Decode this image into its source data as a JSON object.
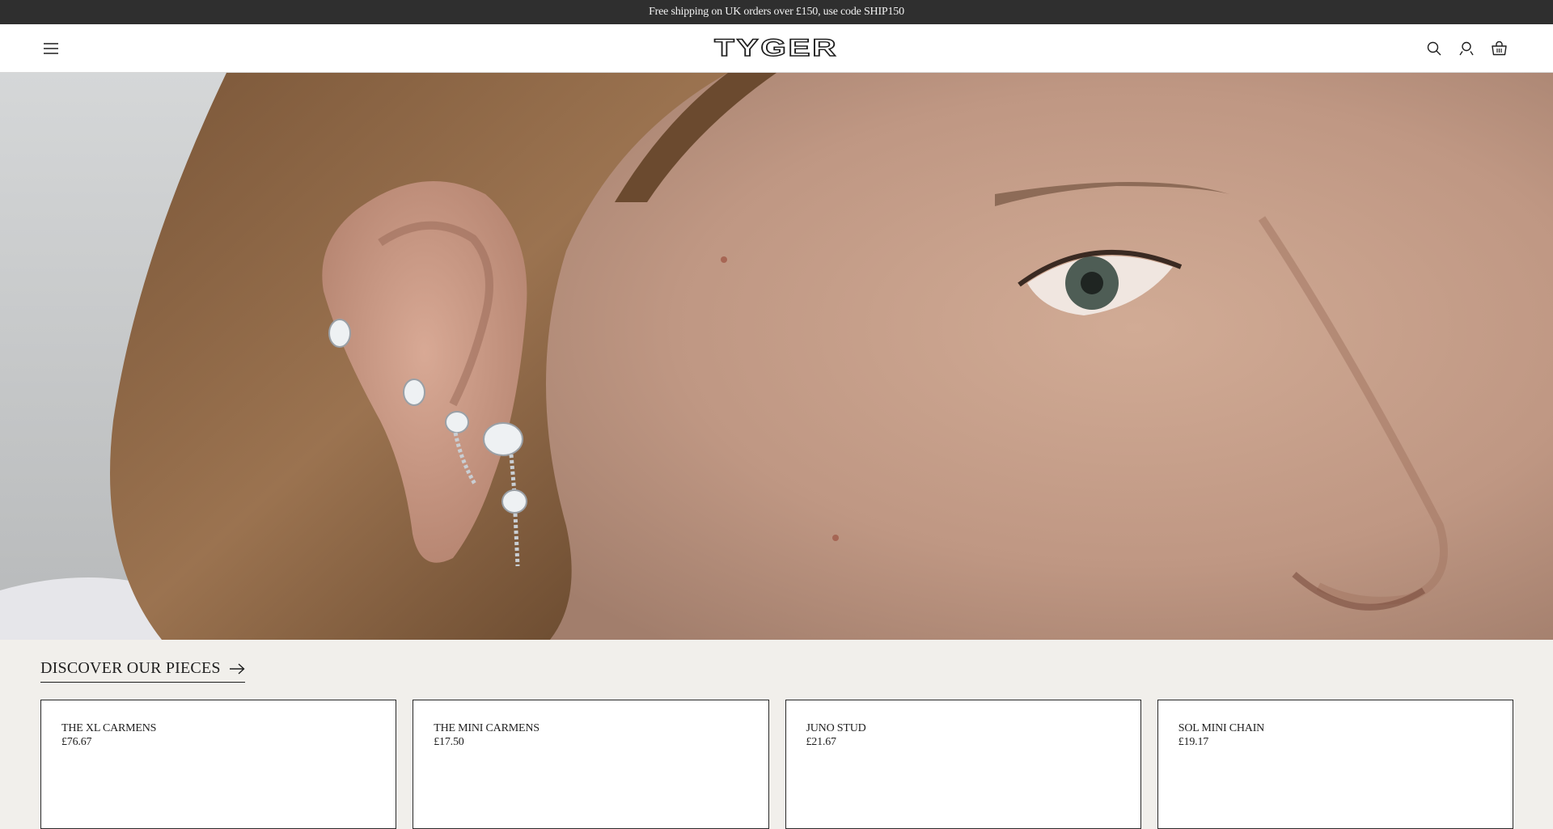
{
  "announcement": {
    "text": "Free shipping on UK orders over £150, use code SHIP150"
  },
  "header": {
    "logo_text": "TYGER",
    "icons": [
      "menu-icon",
      "search-icon",
      "account-icon",
      "basket-icon"
    ]
  },
  "hero": {
    "image": "close-up of ear with silver crystal earrings"
  },
  "discover": {
    "label": "DISCOVER OUR PIECES",
    "icon": "arrow-right-icon"
  },
  "products": [
    {
      "name": "THE XL CARMENS",
      "price": "£76.67"
    },
    {
      "name": "THE MINI CARMENS",
      "price": "£17.50"
    },
    {
      "name": "JUNO STUD",
      "price": "£21.67"
    },
    {
      "name": "SOL MINI CHAIN",
      "price": "£19.17"
    }
  ],
  "colors": {
    "announcement_bg": "#2f2f2f",
    "page_bg": "#f1efeb",
    "text": "#1e1e1e"
  }
}
